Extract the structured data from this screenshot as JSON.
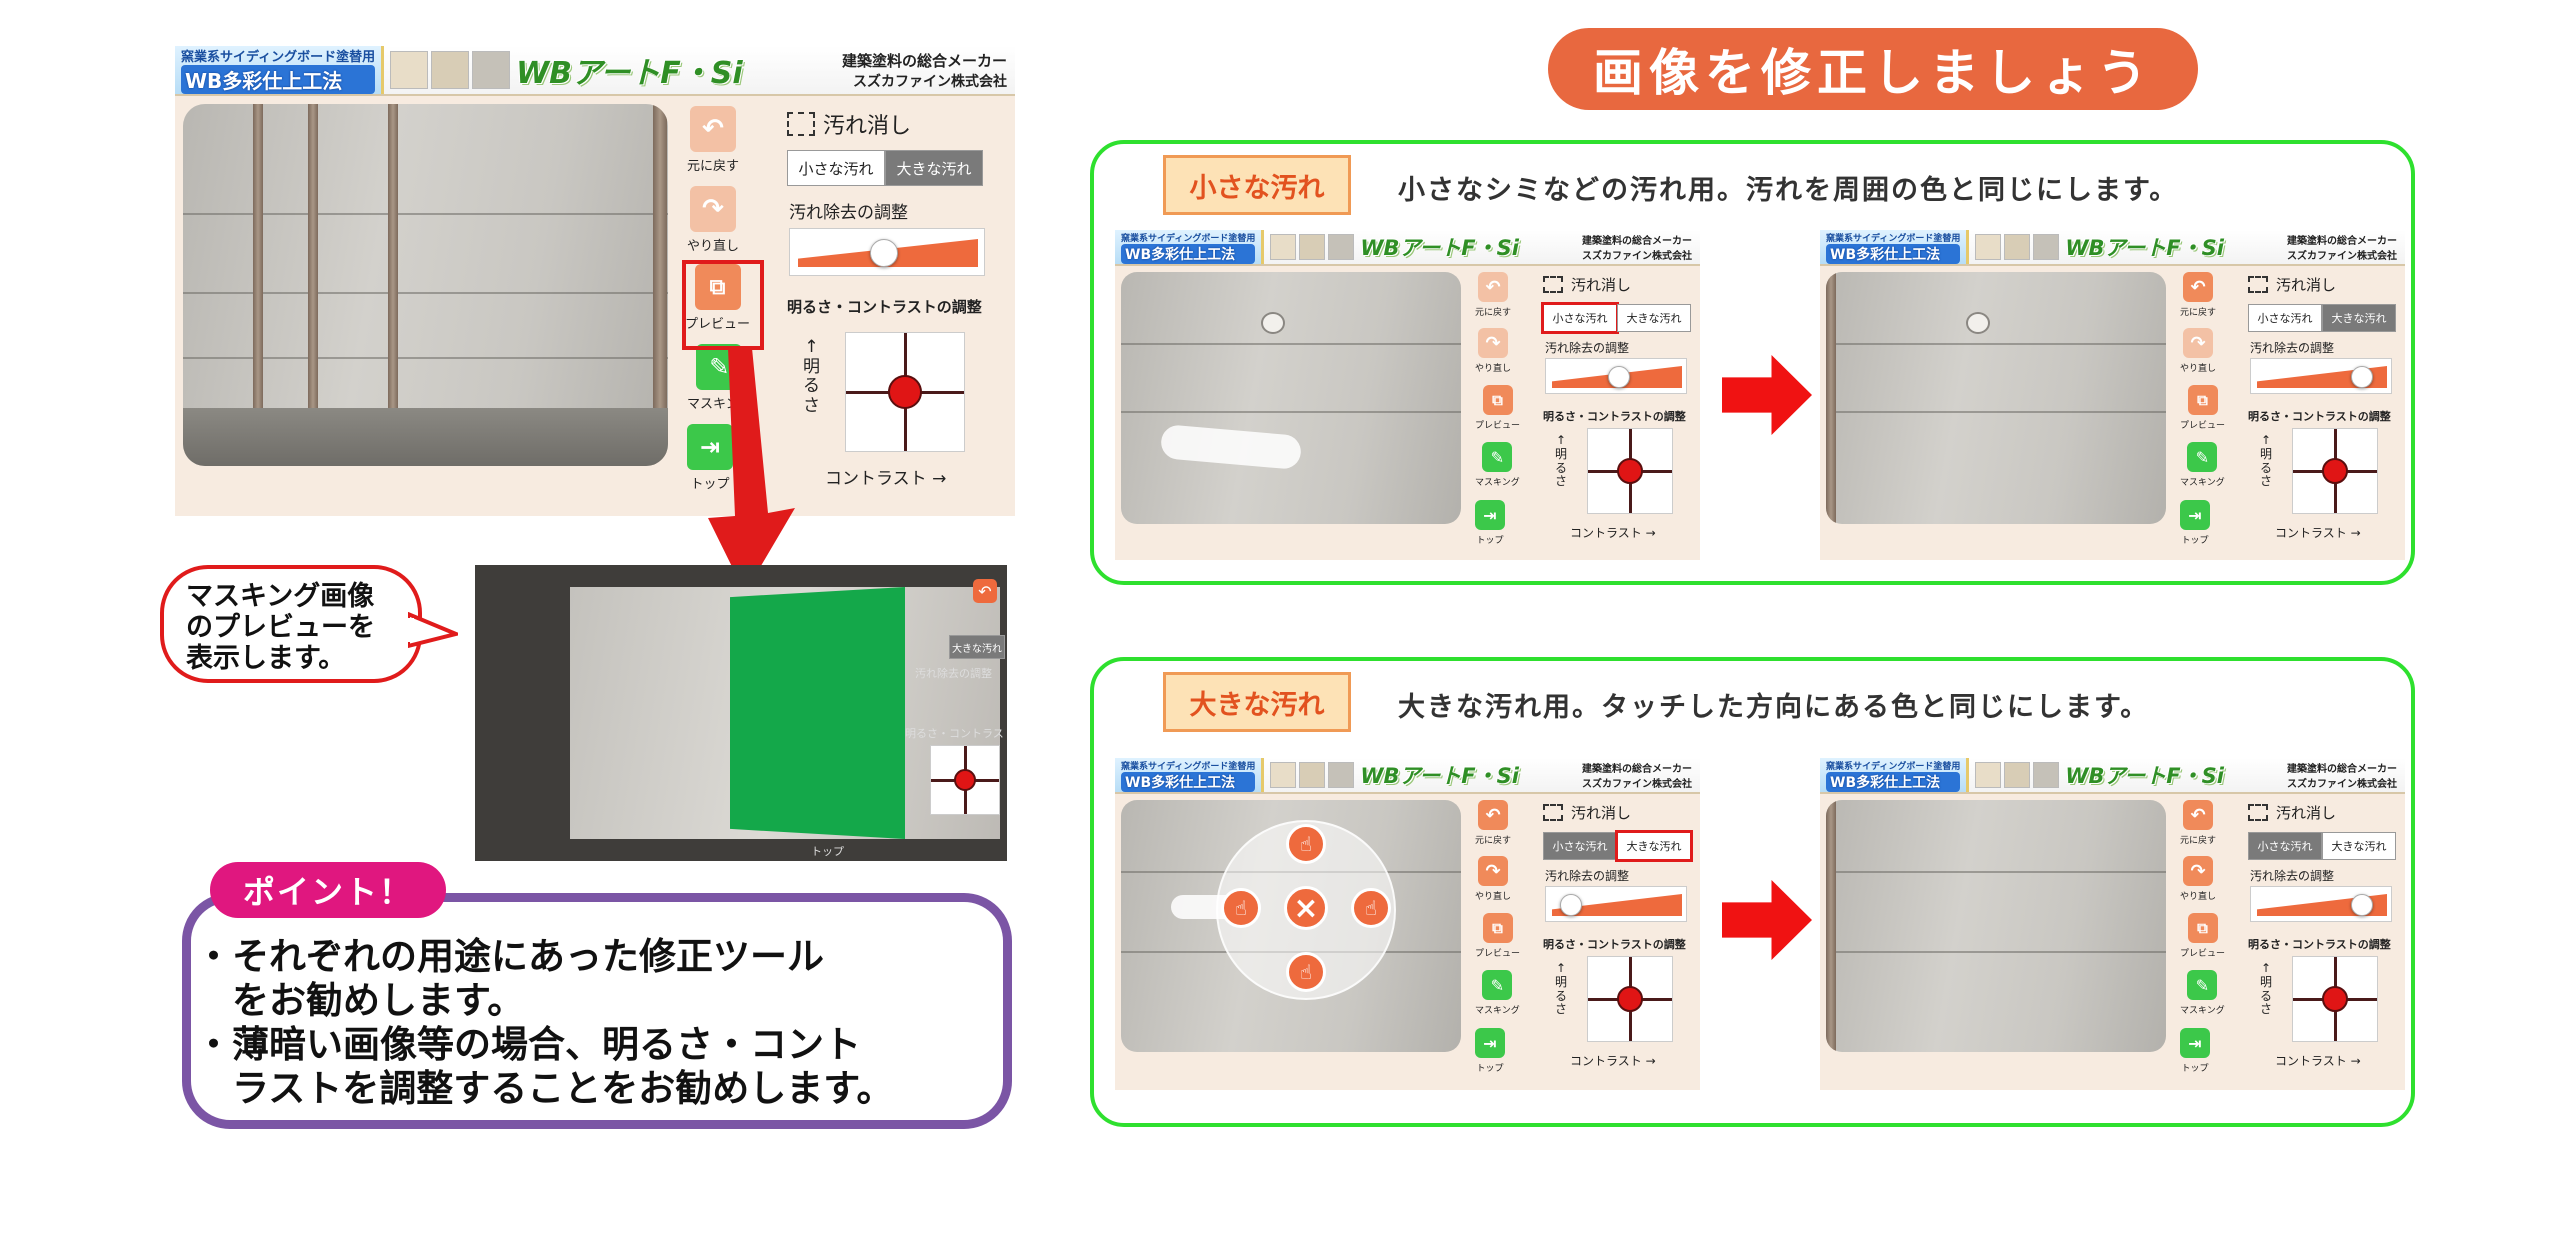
{
  "page_title": "画像を修正しましょう",
  "app": {
    "header_tag_small": "窯業系サイディングボード塗替用",
    "header_tag_big": "WB多彩仕上工法",
    "logo": "WBアートF・Si",
    "maker_line1": "建築塗料の総合メーカー",
    "maker_line2": "スズカファイン株式会社",
    "tools": {
      "undo": "元に戻す",
      "redo": "やり直し",
      "preview": "プレビュー",
      "masking": "マスキング",
      "top": "トップ"
    },
    "panel_title": "汚れ消し",
    "tab_small": "小さな汚れ",
    "tab_large": "大きな汚れ",
    "removal_adjust": "汚れ除去の調整",
    "bc_title": "明るさ・コントラストの調整",
    "brightness_chars": [
      "↑",
      "明",
      "る",
      "さ"
    ],
    "contrast": "コントラスト →",
    "icons": {
      "undo": "undo-icon",
      "redo": "redo-icon",
      "preview": "preview-icon",
      "masking": "edit-icon",
      "top": "exit-icon",
      "select": "dashed-select-icon"
    },
    "colors": {
      "accent": "#ee6a3d",
      "tool_green": "#3cc84a",
      "pad_dot": "#e01515"
    }
  },
  "bubble": {
    "lines": [
      "マスキング画像",
      "のプレビューを",
      "表示します。"
    ]
  },
  "point": {
    "tag": "ポイント！",
    "lines": [
      "・それぞれの用途にあった修正ツール",
      "　をお勧めします。",
      "・薄暗い画像等の場合、明るさ・コント",
      "　ラストを調整することをお勧めします。"
    ]
  },
  "cards": [
    {
      "badge": "小さな汚れ",
      "desc": "小さなシミなどの汚れ用。汚れを周囲の色と同じにします。"
    },
    {
      "badge": "大きな汚れ",
      "desc": "大きな汚れ用。タッチした方向にある色と同じにします。"
    }
  ],
  "preview_shot": {
    "top_label": "トップ",
    "tab_large": "大きな汚れ",
    "removal_adjust": "汚れ除去の調整",
    "bc_title": "明るさ・コントラストの調整"
  },
  "colors": {
    "title_bg": "#e8683f",
    "card_border": "#2ee02e",
    "point_border": "#7b55a5",
    "point_tag": "#e0177f",
    "highlight": "#e01b1b"
  }
}
